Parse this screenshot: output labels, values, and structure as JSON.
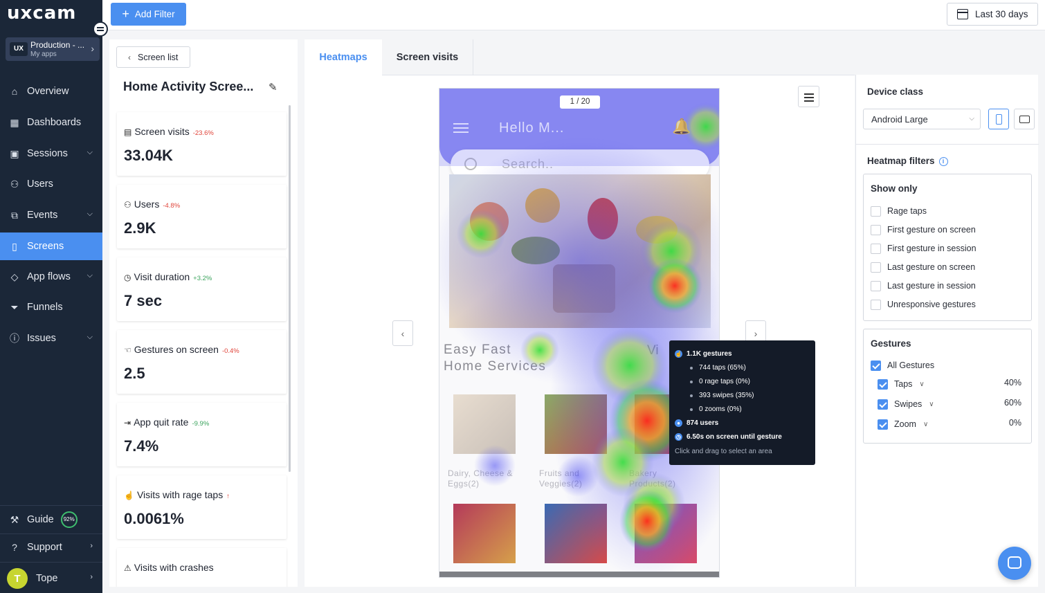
{
  "sidebar": {
    "logo": "uxcam",
    "app": {
      "name": "Production - ...",
      "sub": "My apps",
      "badge": "UX"
    },
    "items": [
      {
        "label": "Overview",
        "icon": "home-icon",
        "expandable": false,
        "active": false
      },
      {
        "label": "Dashboards",
        "icon": "dashboard-icon",
        "expandable": false,
        "active": false
      },
      {
        "label": "Sessions",
        "icon": "sessions-icon",
        "expandable": true,
        "active": false
      },
      {
        "label": "Users",
        "icon": "users-icon",
        "expandable": false,
        "active": false
      },
      {
        "label": "Events",
        "icon": "events-icon",
        "expandable": true,
        "active": false
      },
      {
        "label": "Screens",
        "icon": "screens-icon",
        "expandable": false,
        "active": true
      },
      {
        "label": "App flows",
        "icon": "app-flows-icon",
        "expandable": true,
        "active": false
      },
      {
        "label": "Funnels",
        "icon": "funnels-icon",
        "expandable": false,
        "active": false
      },
      {
        "label": "Issues",
        "icon": "issues-icon",
        "expandable": true,
        "active": false
      }
    ],
    "guide": {
      "label": "Guide",
      "progress": "92%"
    },
    "support": {
      "label": "Support"
    },
    "user": {
      "initial": "T",
      "name": "Tope"
    }
  },
  "topbar": {
    "add_filter": "Add Filter",
    "date_range": "Last 30 days"
  },
  "stats": {
    "back_label": "Screen list",
    "screen_title": "Home Activity Scree...",
    "cards": [
      {
        "title": "Screen visits",
        "delta": "-23.6%",
        "trend": "neg",
        "value": "33.04K",
        "icon": "document-icon"
      },
      {
        "title": "Users",
        "delta": "-4.8%",
        "trend": "neg",
        "value": "2.9K",
        "icon": "users-icon"
      },
      {
        "title": "Visit duration",
        "delta": "+3.2%",
        "trend": "pos",
        "value": "7 sec",
        "icon": "clock-icon"
      },
      {
        "title": "Gestures on screen",
        "delta": "-0.4%",
        "trend": "neg",
        "value": "2.5",
        "icon": "gesture-icon"
      },
      {
        "title": "App quit rate",
        "delta": "-9.9%",
        "trend": "pos",
        "value": "7.4%",
        "icon": "exit-icon"
      },
      {
        "title": "Visits with rage taps",
        "delta": "↑",
        "trend": "neg",
        "value": "0.0061%",
        "icon": "hand-icon"
      },
      {
        "title": "Visits with crashes",
        "delta": "",
        "trend": "neg",
        "value": "",
        "icon": "warning-icon"
      }
    ]
  },
  "center": {
    "tabs": [
      "Heatmaps",
      "Screen visits"
    ],
    "page_indicator": "1 / 20",
    "phone": {
      "greeting": "Hello M...",
      "search_placeholder": "Search..",
      "promo_line1": "Easy Fast",
      "promo_line2": "Home Services",
      "promo_right": "Vi",
      "categories": [
        {
          "line1": "Dairy, Cheese &",
          "line2": "Eggs(2)"
        },
        {
          "line1": "Fruits and",
          "line2": "Veggies(2)"
        },
        {
          "line1": "Bakery",
          "line2": "Products(2)"
        }
      ]
    },
    "tooltip": {
      "gestures": "1.1K gestures",
      "taps": "744 taps (65%)",
      "rage_taps": "0 rage taps (0%)",
      "swipes": "393 swipes (35%)",
      "zooms": "0 zooms (0%)",
      "users": "874 users",
      "time": "6.50s on screen until gesture",
      "hint": "Click and drag to select an area"
    }
  },
  "right": {
    "device_class_title": "Device class",
    "device_value": "Android Large",
    "heatmap_filters_title": "Heatmap filters",
    "show_only": {
      "title": "Show only",
      "options": [
        "Rage taps",
        "First gesture on screen",
        "First gesture in session",
        "Last gesture on screen",
        "Last gesture in session",
        "Unresponsive gestures"
      ]
    },
    "gestures": {
      "title": "Gestures",
      "all_label": "All Gestures",
      "items": [
        {
          "label": "Taps",
          "pct": "40%"
        },
        {
          "label": "Swipes",
          "pct": "60%"
        },
        {
          "label": "Zoom",
          "pct": "0%"
        }
      ]
    }
  },
  "colors": {
    "accent": "#4a8ff0",
    "sidebar_bg": "#1b2738",
    "negative": "#e0443a",
    "positive": "#3aa35c",
    "heat_low": "#6f6ff5",
    "heat_mid": "#35e03a",
    "heat_high": "#ff2a1a"
  }
}
